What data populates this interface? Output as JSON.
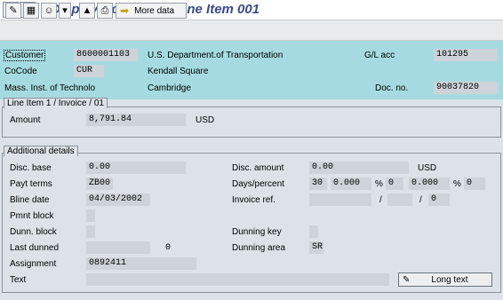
{
  "window": {
    "title": "Display Document: Line Item 001"
  },
  "toolbar": {
    "more_data_label": "More data"
  },
  "header": {
    "customer_label": "Customer",
    "customer_value": "8600001103",
    "customer_name": "U.S. Department.of Transportation",
    "glacc_label": "G/L acc",
    "glacc_value": "101295",
    "cocode_label": "CoCode",
    "cocode_value": "CUR",
    "street": "Kendall Square",
    "company_name": "Mass. Inst. of Technolo",
    "city": "Cambridge",
    "docno_label": "Doc. no.",
    "docno_value": "90037820"
  },
  "line_item": {
    "title": "Line Item 1 / Invoice / 01",
    "amount_label": "Amount",
    "amount_value": "8,791.84",
    "currency": "USD"
  },
  "details": {
    "title": "Additional details",
    "disc_base_label": "Disc. base",
    "disc_base_value": "0.00",
    "disc_amount_label": "Disc. amount",
    "disc_amount_value": "0.00",
    "disc_currency": "USD",
    "payt_terms_label": "Payt terms",
    "payt_terms_value": "ZB00",
    "days_percent_label": "Days/percent",
    "days1": "30",
    "pct1": "0.000",
    "pct_sign1": "%",
    "days2": "0",
    "pct2": "0.000",
    "pct_sign2": "%",
    "days3": "0",
    "bline_label": "Bline date",
    "bline_value": "04/03/2002",
    "invoice_ref_label": "Invoice ref.",
    "invoice_ref_slash1": "/",
    "invoice_ref_slash2": "/",
    "invoice_ref_num": "0",
    "pmnt_block_label": "Pmnt block",
    "dunn_block_label": "Dunn. block",
    "dunning_key_label": "Dunning key",
    "last_dunned_label": "Last dunned",
    "last_dunned_num": "0",
    "dunning_area_label": "Dunning area",
    "dunning_area_value": "SR",
    "assignment_label": "Assignment",
    "assignment_value": "0892411",
    "text_label": "Text",
    "long_text_label": "Long text"
  }
}
